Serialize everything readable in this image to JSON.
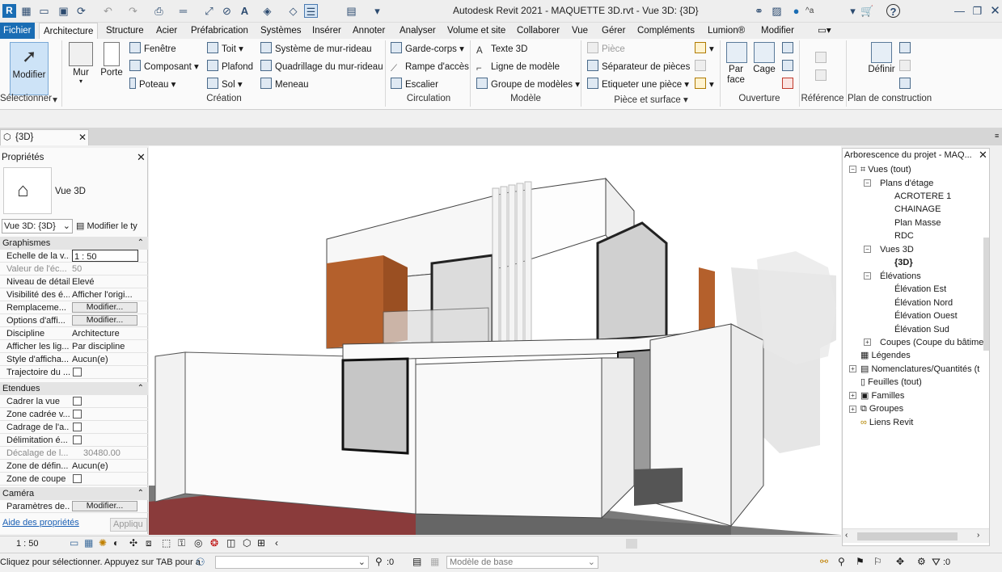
{
  "window": {
    "title": "Autodesk Revit 2021 - MAQUETTE 3D.rvt - Vue 3D: {3D}",
    "user_label": "^a"
  },
  "tabs": [
    "Fichier",
    "Architecture",
    "Structure",
    "Acier",
    "Préfabrication",
    "Systèmes",
    "Insérer",
    "Annoter",
    "Analyser",
    "Volume et site",
    "Collaborer",
    "Vue",
    "Gérer",
    "Compléments",
    "Lumion®",
    "Modifier"
  ],
  "ribbon": {
    "modify_label": "Modifier",
    "select_panel": "Sélectionner",
    "wall": "Mur",
    "door": "Porte",
    "window": "Fenêtre",
    "component": "Composant",
    "column": "Poteau",
    "roof": "Toit",
    "ceiling": "Plafond",
    "floor": "Sol",
    "curtain_system": "Système de mur-rideau",
    "curtain_grid": "Quadrillage du mur-rideau",
    "mullion": "Meneau",
    "build_panel": "Création",
    "railing": "Garde-corps",
    "ramp": "Rampe d'accès",
    "stair": "Escalier",
    "circulation_panel": "Circulation",
    "model_text": "Texte 3D",
    "model_line": "Ligne de modèle",
    "model_group": "Groupe de modèles",
    "model_panel": "Modèle",
    "room": "Pièce",
    "room_separator": "Séparateur de pièces",
    "tag_room": "Etiqueter une pièce",
    "room_area_panel": "Pièce et surface",
    "by_face": "Par face",
    "shaft": "Cage",
    "opening_panel": "Ouverture",
    "datum_panel": "Référence",
    "set_label": "Définir",
    "work_plane_panel": "Plan de construction"
  },
  "view_tab": {
    "label": "{3D}"
  },
  "properties": {
    "title": "Propriétés",
    "type_name": "Vue 3D",
    "selector": "Vue 3D: {3D}",
    "edit_type": "Modifier le ty",
    "groups": [
      {
        "name": "Graphismes",
        "rows": [
          {
            "k": "Echelle de la v...",
            "v": "1 : 50"
          },
          {
            "k": "Valeur de l'éc...",
            "v": "50"
          },
          {
            "k": "Niveau de détail",
            "v": "Elevé"
          },
          {
            "k": "Visibilité des é...",
            "v": "Afficher l'origi..."
          },
          {
            "k": "Remplaceme...",
            "v": "Modifier..."
          },
          {
            "k": "Options d'affi...",
            "v": "Modifier..."
          },
          {
            "k": "Discipline",
            "v": "Architecture"
          },
          {
            "k": "Afficher les lig...",
            "v": "Par discipline"
          },
          {
            "k": "Style d'afficha...",
            "v": "Aucun(e)"
          },
          {
            "k": "Trajectoire du ...",
            "v": ""
          }
        ]
      },
      {
        "name": "Etendues",
        "rows": [
          {
            "k": "Cadrer la vue",
            "v": ""
          },
          {
            "k": "Zone cadrée v...",
            "v": ""
          },
          {
            "k": "Cadrage de l'a...",
            "v": ""
          },
          {
            "k": "Délimitation é...",
            "v": ""
          },
          {
            "k": "Décalage de l...",
            "v": "30480.00"
          },
          {
            "k": "Zone de défin...",
            "v": "Aucun(e)"
          },
          {
            "k": "Zone de coupe",
            "v": ""
          }
        ]
      },
      {
        "name": "Caméra",
        "rows": [
          {
            "k": "Paramètres de...",
            "v": "Modifier..."
          }
        ]
      }
    ],
    "help_link": "Aide des propriétés",
    "apply": "Appliqu"
  },
  "browser": {
    "title": "Arborescence du projet - MAQ...",
    "nodes": [
      "Vues (tout)",
      "Plans d'étage",
      "ACROTERE 1",
      "CHAINAGE",
      "Plan Masse",
      "RDC",
      "Vues 3D",
      "{3D}",
      "Élévations",
      "Élévation Est",
      "Élévation Nord",
      "Élévation Ouest",
      "Élévation Sud",
      "Coupes (Coupe du bâtimen",
      "Légendes",
      "Nomenclatures/Quantités (t",
      "Feuilles (tout)",
      "Familles",
      "Groupes",
      "Liens Revit"
    ]
  },
  "view_control": {
    "scale": "1 : 50"
  },
  "status": {
    "message": "Cliquez pour sélectionner. Appuyez sur TAB pour a",
    "count": ":0",
    "model": "Modèle de base",
    "filter_count": ":0"
  }
}
